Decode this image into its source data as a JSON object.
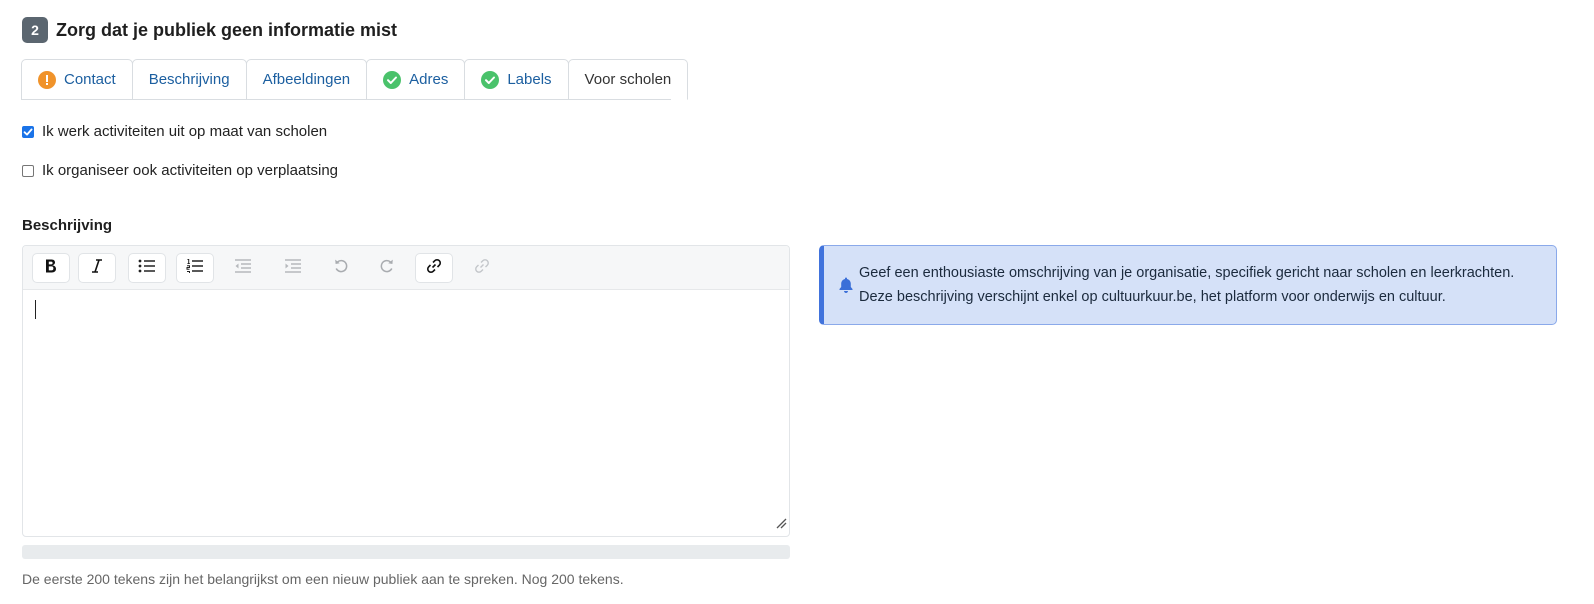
{
  "step": {
    "number": "2",
    "title": "Zorg dat je publiek geen informatie mist"
  },
  "tabs": [
    {
      "label": "Contact",
      "status": "warning"
    },
    {
      "label": "Beschrijving",
      "status": "none"
    },
    {
      "label": "Afbeeldingen",
      "status": "none"
    },
    {
      "label": "Adres",
      "status": "complete"
    },
    {
      "label": "Labels",
      "status": "complete"
    },
    {
      "label": "Voor scholen",
      "status": "active"
    }
  ],
  "checkboxes": [
    {
      "label": "Ik werk activiteiten uit op maat van scholen",
      "checked": true
    },
    {
      "label": "Ik organiseer ook activiteiten op verplaatsing",
      "checked": false
    }
  ],
  "description_field": {
    "label": "Beschrijving",
    "value": "",
    "toolbar": [
      "bold-icon",
      "italic-icon",
      "bullet-list-icon",
      "numbered-list-icon",
      "outdent-icon",
      "indent-icon",
      "undo-icon",
      "redo-icon",
      "link-icon",
      "unlink-icon"
    ],
    "progress_fraction": 0,
    "help_text": "De eerste 200 tekens zijn het belangrijkst om een nieuw publiek aan te spreken. Nog 200 tekens."
  },
  "info": {
    "icon": "bell-icon",
    "lines": [
      "Geef een enthousiaste omschrijving van je organisatie, specifiek gericht naar scholen en leerkrachten.",
      "Deze beschrijving verschijnt enkel op cultuurkuur.be, het platform voor onderwijs en cultuur."
    ]
  },
  "colors": {
    "accent": "#4173dc",
    "info_bg": "#d5e1f8",
    "tab_link": "#1c5fa0",
    "warning": "#f0932b",
    "success": "#4ac26b"
  }
}
